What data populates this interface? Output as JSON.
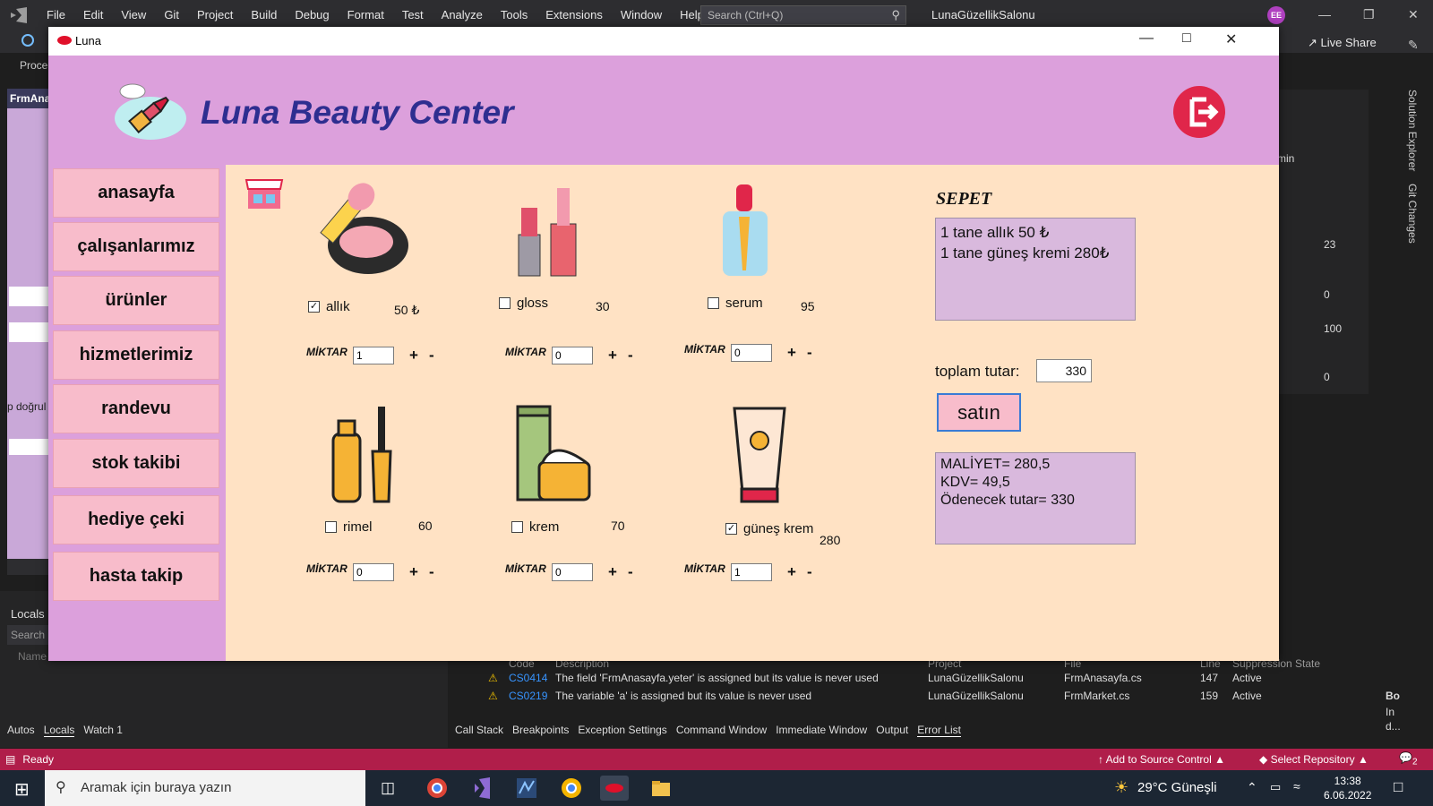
{
  "vs": {
    "menu": [
      "File",
      "Edit",
      "View",
      "Git",
      "Project",
      "Build",
      "Debug",
      "Format",
      "Test",
      "Analyze",
      "Tools",
      "Extensions",
      "Window",
      "Help"
    ],
    "search_placeholder": "Search (Ctrl+Q)",
    "project_title": "LunaGüzellikSalonu",
    "avatar_initials": "EE",
    "live_share": "Live Share",
    "left_tab": "FrmAna",
    "left_proce": "Proce",
    "left_text": "p doğrul",
    "locals_title": "Locals",
    "locals_search": "Search",
    "locals_name_col": "Name",
    "debug_tabs": [
      "Autos",
      "Locals",
      "Watch 1"
    ],
    "right_numbers": [
      "23",
      "0",
      "100",
      "0"
    ],
    "right_min": "min",
    "solution_explorer": "Solution Explorer",
    "git_changes": "Git Changes",
    "error_columns": [
      "Code",
      "Description",
      "Project",
      "File",
      "Line",
      "Suppression State"
    ],
    "errors": [
      {
        "code": "CS0414",
        "desc": "The field 'FrmAnasayfa.yeter' is assigned but its value is never used",
        "project": "LunaGüzellikSalonu",
        "file": "FrmAnasayfa.cs",
        "line": "147",
        "state": "Active"
      },
      {
        "code": "CS0219",
        "desc": "The variable 'a' is assigned but its value is never used",
        "project": "LunaGüzellikSalonu",
        "file": "FrmMarket.cs",
        "line": "159",
        "state": "Active"
      }
    ],
    "bottom_tabs": [
      "Call Stack",
      "Breakpoints",
      "Exception Settings",
      "Command Window",
      "Immediate Window",
      "Output",
      "Error List"
    ],
    "status": "Ready",
    "add_source": "Add to Source Control",
    "select_repo": "Select Repository",
    "right_bo": "Bo",
    "right_in": "In",
    "right_d": "d...",
    "notif_count": "2"
  },
  "taskbar": {
    "search_placeholder": "Aramak için buraya yazın",
    "weather": "29°C  Güneşli",
    "time": "13:38",
    "date": "6.06.2022"
  },
  "luna": {
    "window_title": "Luna",
    "brand": "Luna Beauty Center",
    "nav": [
      "anasayfa",
      "çalışanlarımız",
      "ürünler",
      "hizmetlerimiz",
      "randevu",
      "stok takibi",
      "hediye çeki",
      "hasta takip"
    ],
    "miktar_label": "MİKTAR",
    "plus": "+",
    "minus": "-",
    "products": [
      {
        "name": "allık",
        "price": "50 ₺",
        "checked": true,
        "qty": "1",
        "icon": "blush-compact-icon"
      },
      {
        "name": "gloss",
        "price": "30",
        "checked": false,
        "qty": "0",
        "icon": "lipstick-gloss-icon"
      },
      {
        "name": "serum",
        "price": "95",
        "checked": false,
        "qty": "0",
        "icon": "serum-dropper-icon"
      },
      {
        "name": "rimel",
        "price": "60",
        "checked": false,
        "qty": "0",
        "icon": "mascara-icon"
      },
      {
        "name": "krem",
        "price": "70",
        "checked": false,
        "qty": "0",
        "icon": "cream-jar-icon"
      },
      {
        "name": "güneş krem",
        "price": "280",
        "checked": true,
        "qty": "1",
        "icon": "sunscreen-tube-icon"
      }
    ],
    "cart_title": "SEPET",
    "cart_lines": [
      "1 tane allık 50 ₺",
      "1 tane güneş kremi 280₺"
    ],
    "total_label": "toplam tutar:",
    "total_value": "330",
    "buy_label": "satın",
    "summary_lines": [
      "MALİYET= 280,5",
      "KDV= 49,5",
      "Ödenecek tutar= 330"
    ]
  }
}
